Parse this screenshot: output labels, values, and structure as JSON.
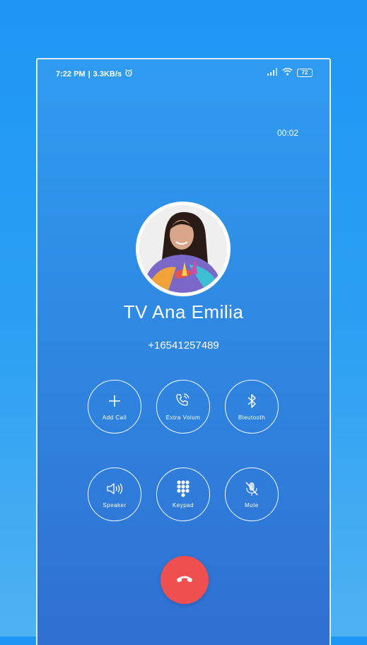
{
  "status_bar": {
    "time": "7:22 PM",
    "separator": "|",
    "speed": "3.3KB/s",
    "battery": "72"
  },
  "call": {
    "duration": "00:02",
    "contact_name": "TV Ana Emilia",
    "phone_number": "+16541257489"
  },
  "controls": [
    {
      "label": "Add Call",
      "icon": "plus-icon"
    },
    {
      "label": "Extra Volum",
      "icon": "phone-volume-icon"
    },
    {
      "label": "Bleutooth",
      "icon": "bluetooth-icon"
    },
    {
      "label": "Speaker",
      "icon": "speaker-icon"
    },
    {
      "label": "Keypad",
      "icon": "keypad-icon"
    },
    {
      "label": "Mute",
      "icon": "mute-mic-icon"
    }
  ],
  "colors": {
    "end_call": "#ef4f4f",
    "background_top": "#2f9cf1",
    "background_bottom": "#2f6fd2"
  }
}
